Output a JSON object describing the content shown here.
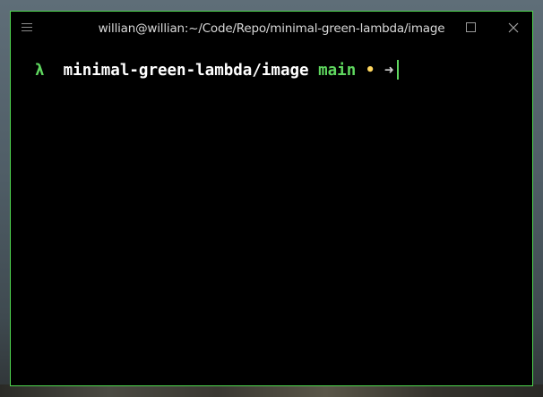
{
  "window": {
    "title": "willian@willian:~/Code/Repo/minimal-green-lambda/image",
    "icons": {
      "menu": "hamburger-menu-icon",
      "maximize": "maximize-icon",
      "close": "close-icon"
    }
  },
  "terminal": {
    "prompt": {
      "symbol": "λ",
      "cwd": "minimal-green-lambda/image",
      "branch": "main",
      "dirty_marker": "•",
      "arrow": "➜"
    }
  },
  "colors": {
    "window_border": "#4fd64f",
    "terminal_bg": "#000000",
    "prompt_green": "#5fd75f",
    "cwd_white": "#ffffff",
    "dirty_yellow": "#ffd75f",
    "title_text": "#d8d8d8"
  }
}
